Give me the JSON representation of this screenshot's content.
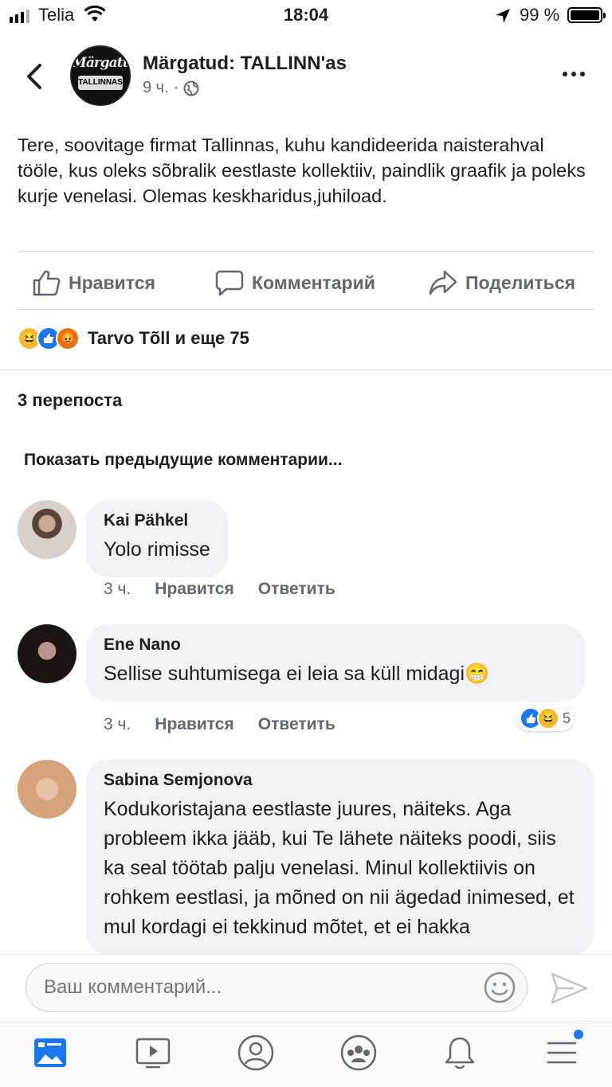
{
  "status_bar": {
    "carrier": "Telia",
    "time": "18:04",
    "battery": "99 %"
  },
  "post": {
    "page_name": "Märgatud: TALLINN'as",
    "logo_text_top": "Märgatud",
    "logo_text_bottom": "TALLINNAS",
    "time": "9 ч.",
    "separator": "·",
    "text": "Tere, soovitage firmat Tallinnas, kuhu kandideerida naisterahval tööle, kus oleks sõbralik eestlaste kollektiiv, paindlik graafik ja poleks kurje venelasi. Olemas keskharidus,juhiload.",
    "actions": {
      "like": "Нравится",
      "comment": "Комментарий",
      "share": "Поделиться"
    },
    "reactions_text": "Tarvo Tõll и еще 75",
    "shares_text": "3 перепоста",
    "previous_comments": "Показать предыдущие комментарии..."
  },
  "comments": [
    {
      "name": "Kai Pähkel",
      "text": "Yolo rimisse",
      "time": "3 ч.",
      "like": "Нравится",
      "reply": "Ответить"
    },
    {
      "name": "Ene Nano",
      "text": "Sellise suhtumisega ei leia sa küll midagi",
      "emoji": "😁",
      "time": "3 ч.",
      "like": "Нравится",
      "reply": "Ответить",
      "reaction_count": "5"
    },
    {
      "name": "Sabina Semjonova",
      "text": "Kodukoristajana eestlaste juures, näiteks. Aga probleem ikka jääb, kui Te lähete näiteks poodi, siis ka seal töötab palju venelasi. Minul kollektiivis on rohkem eestlasi, ja mõned on nii ägedad inimesed, et mul kordagi ei tekkinud mõtet, et ei hakka"
    }
  ],
  "composer": {
    "placeholder": "Ваш комментарий..."
  },
  "icons": {
    "back": "chevron-left-icon",
    "globe": "globe-icon",
    "more": "more-icon",
    "like": "thumbs-up-icon",
    "comment": "comment-icon",
    "share": "share-icon",
    "emoji": "smiley-icon",
    "send": "send-icon",
    "tabs": [
      "news-feed-icon",
      "watch-icon",
      "profile-icon",
      "groups-icon",
      "bell-icon",
      "menu-icon"
    ]
  },
  "colors": {
    "accent": "#1877f2",
    "text": "#1c1e21",
    "secondary_text": "#606770",
    "bubble": "#f0f2f5"
  }
}
